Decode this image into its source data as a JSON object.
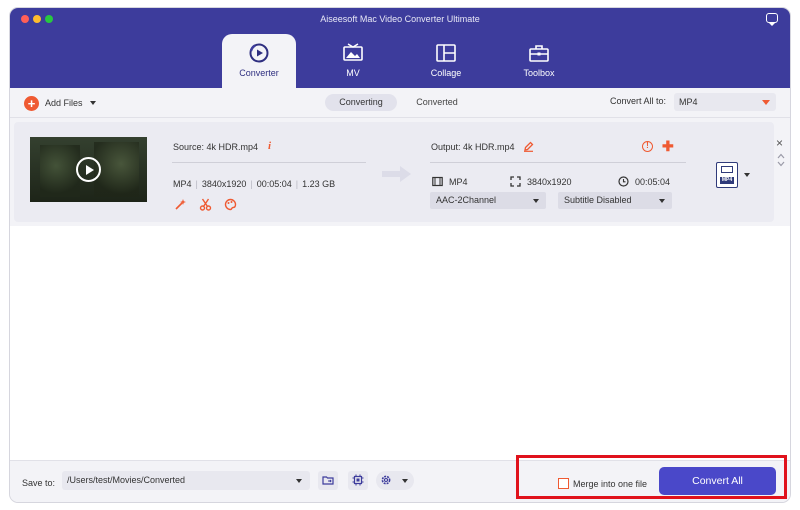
{
  "window": {
    "title": "Aiseesoft Mac Video Converter Ultimate"
  },
  "nav_tabs": [
    {
      "label": "Converter",
      "icon": "converter-icon",
      "active": true
    },
    {
      "label": "MV",
      "icon": "mv-icon",
      "active": false
    },
    {
      "label": "Collage",
      "icon": "collage-icon",
      "active": false
    },
    {
      "label": "Toolbox",
      "icon": "toolbox-icon",
      "active": false
    }
  ],
  "toolbar": {
    "add_files_label": "Add Files",
    "segments": [
      "Converting",
      "Converted"
    ],
    "convert_all_to_label": "Convert All to:",
    "convert_all_to_value": "MP4"
  },
  "file": {
    "source_label": "Source: 4k HDR.mp4",
    "info_glyph": "i",
    "format": "MP4",
    "resolution": "3840x1920",
    "duration": "00:05:04",
    "size": "1.23 GB",
    "output_label": "Output: 4k HDR.mp4",
    "output_format": "MP4",
    "output_resolution": "3840x1920",
    "output_duration": "00:05:04",
    "audio_track": "AAC-2Channel",
    "subtitle": "Subtitle Disabled",
    "close_glyph": "×",
    "warn_glyph": "!",
    "plus_glyph": "✚",
    "badge_text": "MP4"
  },
  "bottom": {
    "save_to_label": "Save to:",
    "save_path": "/Users/test/Movies/Converted",
    "merge_label": "Merge into one file",
    "merge_checked": false,
    "convert_all_label": "Convert All"
  },
  "colors": {
    "header_bg": "#3d3c9c",
    "accent_orange": "#ef5a32",
    "primary_button": "#4a48c9",
    "highlight_red": "#e0121c"
  }
}
